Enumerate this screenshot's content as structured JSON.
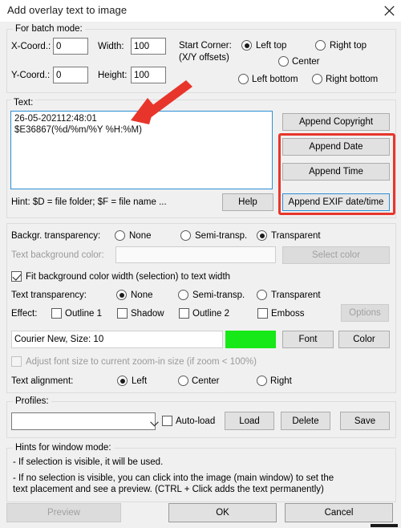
{
  "window": {
    "title": "Add overlay text to image",
    "close_icon": "close-icon"
  },
  "batch_group": {
    "legend": "For batch mode:",
    "x_label": "X-Coord.:",
    "x_value": "0",
    "y_label": "Y-Coord.:",
    "y_value": "0",
    "width_label": "Width:",
    "width_value": "100",
    "height_label": "Height:",
    "height_value": "100",
    "start_corner_label": "Start Corner:",
    "start_corner_sub": "(X/Y offsets)",
    "corners": [
      {
        "label": "Left top",
        "selected": true
      },
      {
        "label": "Right top",
        "selected": false
      },
      {
        "label": "Center",
        "selected": false
      },
      {
        "label": "Left bottom",
        "selected": false
      },
      {
        "label": "Right bottom",
        "selected": false
      }
    ]
  },
  "text_group": {
    "label": "Text:",
    "value": "26-05-202112:48:01\n$E36867(%d/%m/%Y %H:%M)",
    "hint": "Hint: $D = file folder; $F = file name ...",
    "help_button": "Help",
    "append_copyright": "Append Copyright",
    "append_date": "Append Date",
    "append_time": "Append Time",
    "append_exif": "Append EXIF date/time"
  },
  "transparency_group": {
    "backgr_label": "Backgr. transparency:",
    "backgr_options": [
      {
        "label": "None",
        "selected": false
      },
      {
        "label": "Semi-transp.",
        "selected": false
      },
      {
        "label": "Transparent",
        "selected": true
      }
    ],
    "text_bg_color_label": "Text background color:",
    "text_bg_color_value": "",
    "select_color_button": "Select color",
    "fit_bg_checkbox": "Fit background color width (selection) to text width",
    "fit_bg_checked": true,
    "text_transp_label": "Text transparency:",
    "text_transp_options": [
      {
        "label": "None",
        "selected": true
      },
      {
        "label": "Semi-transp.",
        "selected": false
      },
      {
        "label": "Transparent",
        "selected": false
      }
    ],
    "effect_label": "Effect:",
    "effects": [
      {
        "label": "Outline 1",
        "checked": false
      },
      {
        "label": "Shadow",
        "checked": false
      },
      {
        "label": "Outline 2",
        "checked": false
      },
      {
        "label": "Emboss",
        "checked": false
      }
    ],
    "options_button": "Options",
    "font_value": "Courier New, Size: 10",
    "font_color": "#17e817",
    "font_button": "Font",
    "color_button": "Color",
    "adjust_font_checkbox": "Adjust font size to current zoom-in size (if zoom < 100%)",
    "adjust_font_checked": false,
    "alignment_label": "Text alignment:",
    "alignment_options": [
      {
        "label": "Left",
        "selected": true
      },
      {
        "label": "Center",
        "selected": false
      },
      {
        "label": "Right",
        "selected": false
      }
    ]
  },
  "profiles_group": {
    "legend": "Profiles:",
    "combo_value": "",
    "autoload_label": "Auto-load",
    "autoload_checked": false,
    "load_button": "Load",
    "delete_button": "Delete",
    "save_button": "Save"
  },
  "hints_group": {
    "legend": "Hints for window mode:",
    "line1": "- If selection is visible, it will be used.",
    "line2": "- If no selection is visible, you can click into the image (main window) to set the",
    "line3": "  text placement and see a preview. (CTRL + Click adds the text permanently)"
  },
  "footer": {
    "preview_button": "Preview",
    "ok_button": "OK",
    "cancel_button": "Cancel"
  },
  "annotations": {
    "highlight_color": "#e8352b",
    "arrow": "red-arrow-annotation",
    "box": "red-highlight-box-annotation"
  }
}
